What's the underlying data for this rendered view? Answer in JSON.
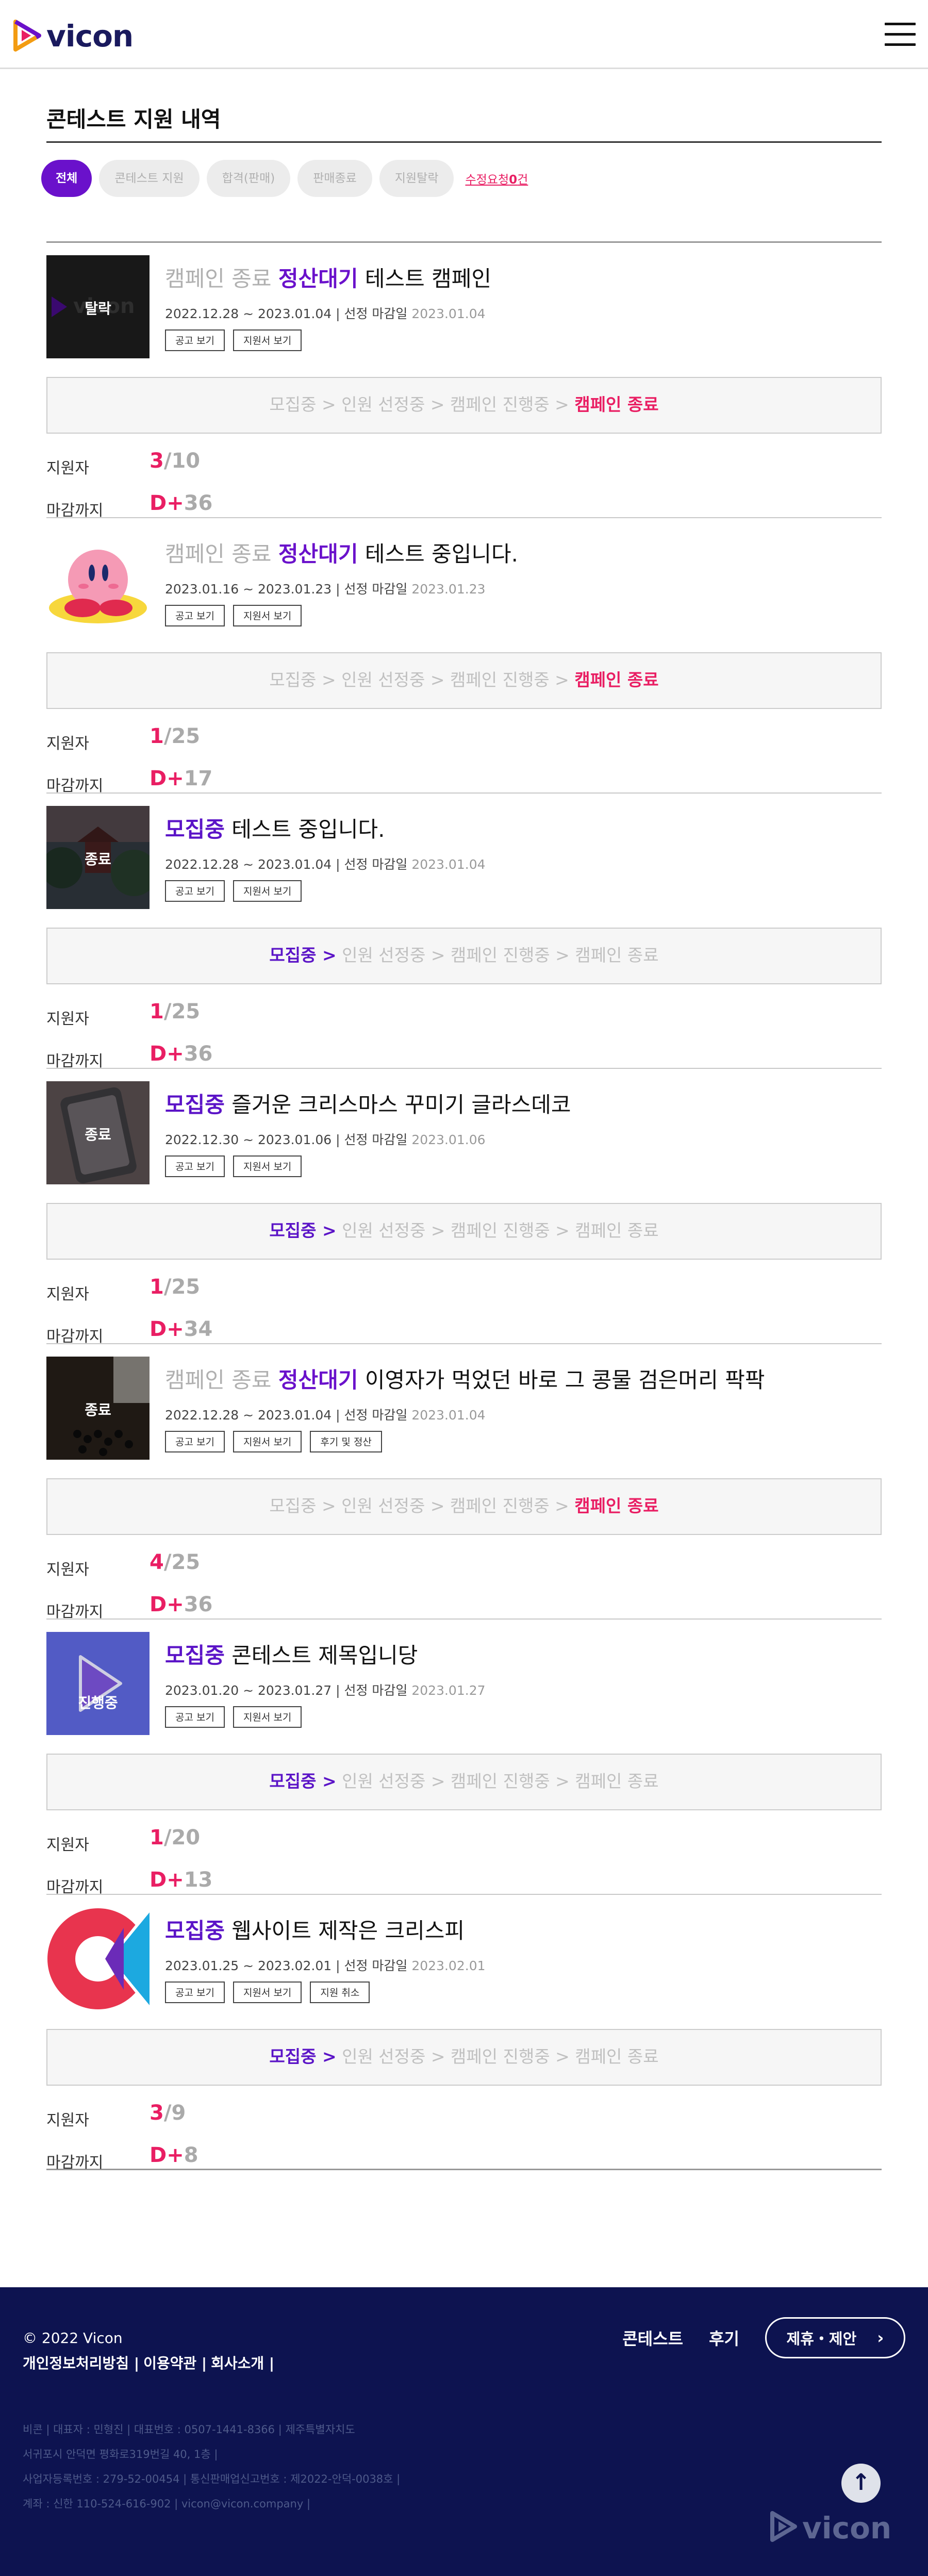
{
  "brand": {
    "name": "vicon"
  },
  "page": {
    "title": "콘테스트 지원 내역"
  },
  "filters": {
    "items": [
      "전체",
      "콘테스트 지원",
      "합격(판매)",
      "판매종료",
      "지원탈락"
    ],
    "edit_request_prefix": "수정요청",
    "edit_request_count": "0",
    "edit_request_suffix": "건"
  },
  "labels": {
    "applicants": "지원자",
    "deadline": "마감까지",
    "d_plus": "D+",
    "ad_view": "공고 보기",
    "application_view": "지원서 보기",
    "review_settle": "후기 및 정산",
    "cancel_application": "지원 취소",
    "deadline_label": "선정 마감일"
  },
  "progress_steps": [
    "모집중",
    "인원 선정중",
    "캠페인 진행중",
    "캠페인 종료"
  ],
  "contests": [
    {
      "status": "캠페인 종료",
      "status2": "정산대기",
      "title": "테스트 캠페인",
      "start": "2022.12.28",
      "end": "2023.01.04",
      "deadline": "2023.01.04",
      "thumb_label": "탈락",
      "buttons": [
        "공고 보기",
        "지원서 보기"
      ],
      "active_step": 3,
      "applied": "3",
      "capacity": "/10",
      "days": "36"
    },
    {
      "status": "캠페인 종료",
      "status2": "정산대기",
      "title": "테스트 중입니다.",
      "start": "2023.01.16",
      "end": "2023.01.23",
      "deadline": "2023.01.23",
      "thumb_label": "",
      "buttons": [
        "공고 보기",
        "지원서 보기"
      ],
      "active_step": 3,
      "applied": "1",
      "capacity": "/25",
      "days": "17"
    },
    {
      "status": "모집중",
      "status2": "",
      "title": "테스트 중입니다.",
      "start": "2022.12.28",
      "end": "2023.01.04",
      "deadline": "2023.01.04",
      "thumb_label": "종료",
      "buttons": [
        "공고 보기",
        "지원서 보기"
      ],
      "active_step": 0,
      "applied": "1",
      "capacity": "/25",
      "days": "36"
    },
    {
      "status": "모집중",
      "status2": "",
      "title": "즐거운 크리스마스 꾸미기 글라스데코",
      "start": "2022.12.30",
      "end": "2023.01.06",
      "deadline": "2023.01.06",
      "thumb_label": "종료",
      "buttons": [
        "공고 보기",
        "지원서 보기"
      ],
      "active_step": 0,
      "applied": "1",
      "capacity": "/25",
      "days": "34"
    },
    {
      "status": "캠페인 종료",
      "status2": "정산대기",
      "title": "이영자가 먹었던 바로 그 콩물 검은머리 팍팍",
      "start": "2022.12.28",
      "end": "2023.01.04",
      "deadline": "2023.01.04",
      "thumb_label": "종료",
      "buttons": [
        "공고 보기",
        "지원서 보기",
        "후기 및 정산"
      ],
      "active_step": 3,
      "applied": "4",
      "capacity": "/25",
      "days": "36"
    },
    {
      "status": "모집중",
      "status2": "",
      "title": "콘테스트 제목입니당",
      "start": "2023.01.20",
      "end": "2023.01.27",
      "deadline": "2023.01.27",
      "thumb_label": "진행중",
      "buttons": [
        "공고 보기",
        "지원서 보기"
      ],
      "active_step": 0,
      "applied": "1",
      "capacity": "/20",
      "days": "13"
    },
    {
      "status": "모집중",
      "status2": "",
      "title": "웹사이트 제작은 크리스피",
      "start": "2023.01.25",
      "end": "2023.02.01",
      "deadline": "2023.02.01",
      "thumb_label": "",
      "buttons": [
        "공고 보기",
        "지원서 보기",
        "지원 취소"
      ],
      "active_step": 0,
      "applied": "3",
      "capacity": "/9",
      "days": "8"
    }
  ],
  "footer": {
    "copyright": "© 2022 Vicon",
    "links": [
      "개인정보처리방침 |",
      "이용약관 |",
      "회사소개 |"
    ],
    "nav": [
      "콘테스트",
      "후기"
    ],
    "partner_button": "제휴・제안",
    "info_lines": [
      "비콘 | 대표자 : 민형진 | 대표번호 : 0507-1441-8366 | 제주특별자치도",
      "서귀포시 안덕면 평화로319번길 40, 1층 |",
      "사업자등록번호 : 279-52-00454 | 통신판매업신고번호 : 제2022-안덕-0038호 |",
      "계좌 : 신한 110-524-616-902 | vicon@vicon.company |"
    ]
  },
  "colors": {
    "primary": "#6a11cb",
    "accent": "#e91e63",
    "footer_bg": "#0d1350"
  }
}
